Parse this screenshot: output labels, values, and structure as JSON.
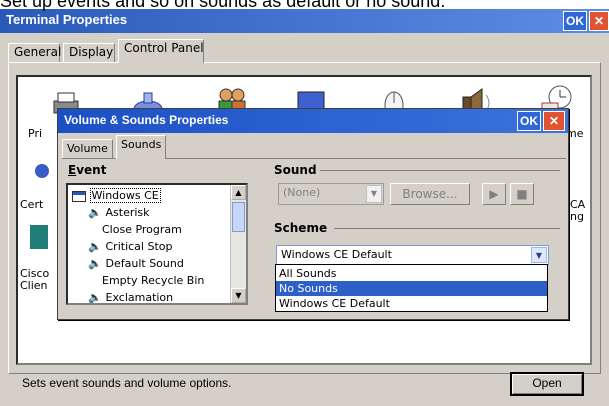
{
  "caption": "Set up events and so on sounds as default or no sound.",
  "window": {
    "title": "Terminal Properties",
    "ok_label": "OK",
    "close_label": "✕",
    "tabs": [
      {
        "label": "General"
      },
      {
        "label": "Display"
      },
      {
        "label": "Control Panel"
      }
    ],
    "icons": [
      {
        "label": "Pri"
      },
      {
        "label": "me"
      },
      {
        "label": "Cert"
      },
      {
        "label": "CA"
      },
      {
        "label": "ng"
      },
      {
        "label": "Cisco"
      },
      {
        "label": "Clien"
      }
    ],
    "status_text": "Sets event sounds and volume options.",
    "open_label": "Open"
  },
  "dialog": {
    "title": "Volume & Sounds Properties",
    "ok_label": "OK",
    "close_label": "✕",
    "tabs": [
      {
        "label": "Volume"
      },
      {
        "label": "Sounds"
      }
    ],
    "event_label": "Event",
    "events": [
      {
        "label": "Windows CE",
        "icon": "window-icon"
      },
      {
        "label": "Asterisk",
        "icon": "speaker-icon"
      },
      {
        "label": "Close Program",
        "icon": "none"
      },
      {
        "label": "Critical Stop",
        "icon": "speaker-icon"
      },
      {
        "label": "Default Sound",
        "icon": "speaker-icon"
      },
      {
        "label": "Empty Recycle Bin",
        "icon": "none"
      },
      {
        "label": "Exclamation",
        "icon": "speaker-icon"
      }
    ],
    "sound_label": "Sound",
    "sound_value": "(None)",
    "browse_label": "Browse...",
    "play_symbol": "▶",
    "stop_symbol": "■",
    "scheme_label": "Scheme",
    "scheme_value": "Windows CE Default",
    "scheme_options": [
      {
        "label": "All Sounds",
        "selected": false
      },
      {
        "label": "No Sounds",
        "selected": true
      },
      {
        "label": "Windows CE Default",
        "selected": false
      }
    ]
  },
  "colors": {
    "titlebar": "#2a5ab9",
    "selection": "#2d5fc8",
    "close_button": "#e0542f"
  }
}
